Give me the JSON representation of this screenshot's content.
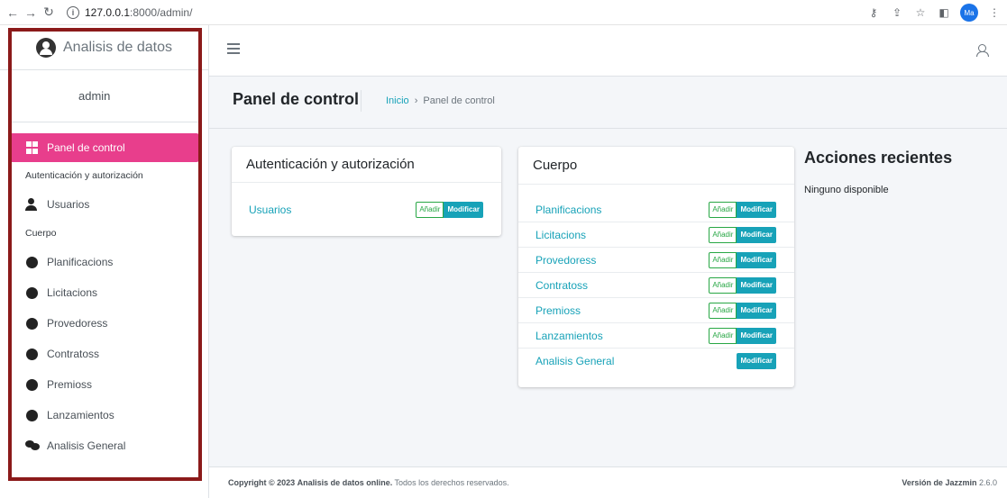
{
  "browser": {
    "url_host": "127.0.0.1",
    "url_rest": ":8000/admin/",
    "profile_initials": "Ma"
  },
  "sidebar": {
    "brand": "Analisis de datos",
    "user": "admin",
    "active_item": "Panel de control",
    "section_auth": "Autenticación y autorización",
    "auth_items": [
      {
        "label": "Usuarios",
        "icon": "user-icon"
      }
    ],
    "section_body": "Cuerpo",
    "body_items": [
      {
        "label": "Planificacions",
        "icon": "circle-icon"
      },
      {
        "label": "Licitacions",
        "icon": "circle-icon"
      },
      {
        "label": "Provedoress",
        "icon": "circle-icon"
      },
      {
        "label": "Contratoss",
        "icon": "circle-icon"
      },
      {
        "label": "Premioss",
        "icon": "circle-icon"
      },
      {
        "label": "Lanzamientos",
        "icon": "circle-icon"
      },
      {
        "label": "Analisis General",
        "icon": "comments-icon"
      }
    ]
  },
  "header": {
    "title": "Panel de control",
    "breadcrumb_home": "Inicio",
    "breadcrumb_sep": "›",
    "breadcrumb_current": "Panel de control"
  },
  "auth_card": {
    "title": "Autenticación y autorización",
    "rows": [
      {
        "label": "Usuarios",
        "add": "Añadir",
        "change": "Modificar"
      }
    ]
  },
  "body_card": {
    "title": "Cuerpo",
    "rows": [
      {
        "label": "Planificacions",
        "add": "Añadir",
        "change": "Modificar"
      },
      {
        "label": "Licitacions",
        "add": "Añadir",
        "change": "Modificar"
      },
      {
        "label": "Provedoress",
        "add": "Añadir",
        "change": "Modificar"
      },
      {
        "label": "Contratoss",
        "add": "Añadir",
        "change": "Modificar"
      },
      {
        "label": "Premioss",
        "add": "Añadir",
        "change": "Modificar"
      },
      {
        "label": "Lanzamientos",
        "add": "Añadir",
        "change": "Modificar"
      },
      {
        "label": "Analisis General",
        "change": "Modificar"
      }
    ]
  },
  "recent": {
    "title": "Acciones recientes",
    "empty": "Ninguno disponible"
  },
  "footer": {
    "copyright_prefix": "Copyright © 2023",
    "copyright_bold": "Analisis de datos online.",
    "copyright_suffix": "Todos los derechos reservados.",
    "version_label": "Versión de Jazzmin",
    "version": "2.6.0"
  },
  "colors": {
    "active_nav": "#e83e8c",
    "link": "#17a2b8",
    "add_button": "#28a745",
    "highlight_frame": "#8b1a1a"
  }
}
